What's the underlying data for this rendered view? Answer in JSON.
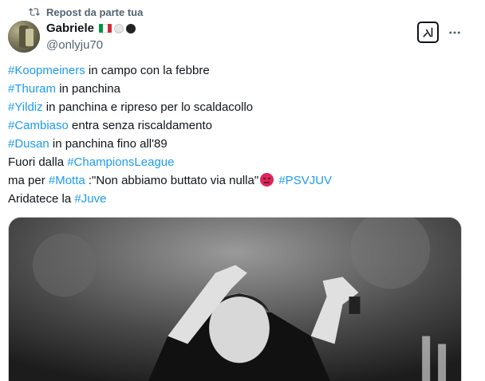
{
  "repost": {
    "label": "Repost da parte tua",
    "icon": "repost-icon"
  },
  "author": {
    "display_name": "Gabriele",
    "handle": "@onlyju70",
    "flag_colors": [
      "#009246",
      "#ffffff",
      "#ce2b37"
    ],
    "badges": [
      "white-circle",
      "black-circle"
    ]
  },
  "actions": {
    "grok": "grok-icon",
    "more": "more-icon"
  },
  "tweet": {
    "lines": [
      {
        "tag": "#Koopmeiners",
        "text": " in campo con la febbre"
      },
      {
        "tag": "#Thuram",
        "text": " in panchina"
      },
      {
        "tag": "#Yildiz",
        "text": " in panchina e ripreso per lo scaldacollo"
      },
      {
        "tag": "#Cambiaso",
        "text": " entra senza riscaldamento"
      },
      {
        "tag": "#Dusan",
        "text": " in panchina fino all'89"
      },
      {
        "pre": "Fuori dalla ",
        "tag": "#ChampionsLeague"
      },
      {
        "pre": "ma per ",
        "tag": "#Motta",
        "text": " :\"Non abbiamo buttato via nulla\"",
        "emoji": "angry-face",
        "tag2": "#PSVJUV"
      },
      {
        "pre": "Aridatece la ",
        "tag": "#Juve"
      }
    ]
  },
  "colors": {
    "hashtag": "#1d9bf0",
    "secondary": "#536471",
    "text": "#0f1419"
  },
  "media": {
    "type": "photo",
    "description_icon": "coach-photo"
  }
}
